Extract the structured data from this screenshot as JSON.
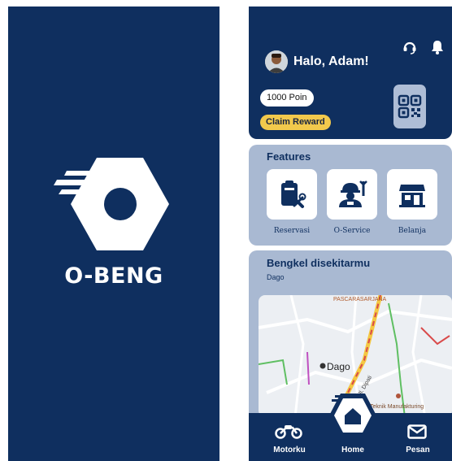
{
  "splash": {
    "brand": "O-BENG",
    "logo_icon": "hex-nut-logo-icon",
    "background": "#0f2f5f"
  },
  "header": {
    "greeting": "Halo, Adam!",
    "points": "1000 Poin",
    "claim_label": "Claim Reward",
    "icons": [
      "headset-icon",
      "bell-icon",
      "qr-code-icon"
    ]
  },
  "features": {
    "title": "Features",
    "items": [
      {
        "label": "Reservasi",
        "icon": "clipboard-tools-icon"
      },
      {
        "label": "O-Service",
        "icon": "mechanic-icon"
      },
      {
        "label": "Belanja",
        "icon": "store-icon"
      }
    ]
  },
  "bengkel": {
    "title": "Bengkel disekitarmu",
    "location": "Dago",
    "map_labels": {
      "area_top": "PASCARASARJANA",
      "center": "Dago",
      "road": "Jl. Dipati",
      "place": "Teknik Manufakturing"
    }
  },
  "nav": {
    "items": [
      {
        "label": "Motorku",
        "icon": "motorcycle-icon"
      },
      {
        "label": "Home",
        "icon": "home-icon"
      },
      {
        "label": "Pesan",
        "icon": "envelope-icon"
      }
    ]
  },
  "colors": {
    "navy": "#0f2f5f",
    "panel": "#a9b9d2",
    "accent_yellow": "#f2c94c"
  }
}
